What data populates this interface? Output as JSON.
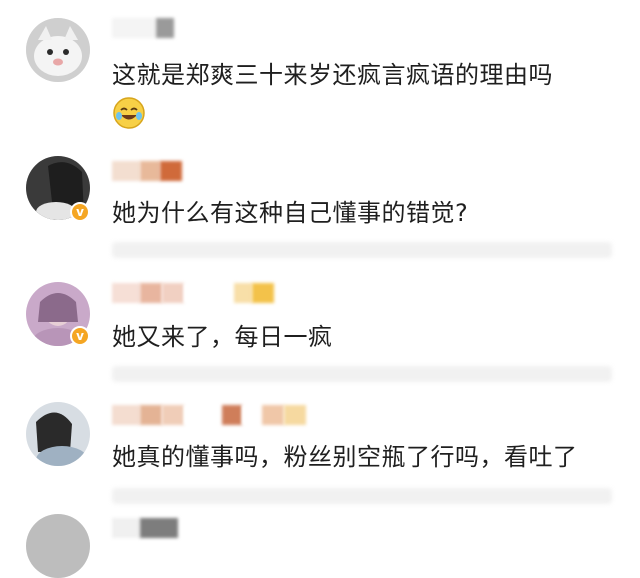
{
  "comments": [
    {
      "text": "这就是郑爽三十来岁还疯言疯语的理由吗",
      "emoji": "laughing-crying-emoji",
      "verified": false
    },
    {
      "text": "她为什么有这种自己懂事的错觉?",
      "verified": true
    },
    {
      "text": "她又来了，每日一疯",
      "verified": true
    },
    {
      "text": "她真的懂事吗，粉丝别空瓶了行吗，看吐了",
      "verified": false
    }
  ],
  "colors": {
    "badge": "#f5a623",
    "text": "#1f1f1f",
    "blur_bar": "#f1f1f1"
  }
}
